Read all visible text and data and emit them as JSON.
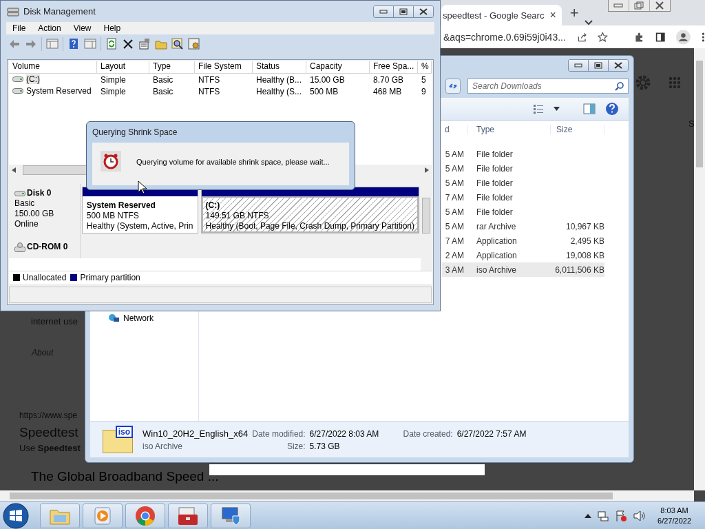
{
  "browser": {
    "tab_title": "speedtest - Google Searc",
    "tab_close": "×",
    "new_tab": "+",
    "url": "&aqs=chrome.0.69i59j0i43...",
    "page_texts": [
      {
        "kind": "snippet",
        "text": "internet use"
      },
      {
        "kind": "about",
        "text": "About"
      },
      {
        "kind": "url",
        "text": "https://www.spe"
      },
      {
        "kind": "title",
        "text": "Speedtest"
      },
      {
        "kind": "snippet",
        "text": "Use **Speedtest**"
      },
      {
        "kind": "heading",
        "text": "The Global Broadband Speed ..."
      }
    ],
    "side_text": "S"
  },
  "explorer": {
    "search_placeholder": "Search Downloads",
    "columns": [
      "d",
      "Type",
      "Size"
    ],
    "rows": [
      {
        "date": "5 AM",
        "type": "File folder",
        "selected": false
      },
      {
        "date": "5 AM",
        "type": "File folder",
        "selected": false
      },
      {
        "date": "5 AM",
        "type": "File folder",
        "selected": false
      },
      {
        "date": "7 AM",
        "type": "File folder",
        "selected": false
      },
      {
        "date": "5 AM",
        "type": "File folder",
        "selected": false
      },
      {
        "date": "5 AM",
        "type": "rar Archive",
        "size": "10,967 KB",
        "selected": false
      },
      {
        "date": "7 AM",
        "type": "Application",
        "size": "2,495 KB",
        "selected": false
      },
      {
        "date": "2 AM",
        "type": "Application",
        "size": "19,008 KB",
        "selected": false
      },
      {
        "date": "3 AM",
        "type": "iso Archive",
        "size": "6,011,506 KB",
        "selected": true
      }
    ],
    "nav_items": [
      {
        "label": "Network"
      }
    ],
    "details": {
      "icon_label": "iso",
      "name": "Win10_20H2_English_x64",
      "type": "iso Archive",
      "modified_label": "Date modified:",
      "modified": "6/27/2022 8:03 AM",
      "created_label": "Date created:",
      "created": "6/27/2022 7:57 AM",
      "size_label": "Size:",
      "size": "5.73 GB"
    }
  },
  "disk_management": {
    "title": "Disk Management",
    "menu": [
      "File",
      "Action",
      "View",
      "Help"
    ],
    "columns": [
      "Volume",
      "Layout",
      "Type",
      "File System",
      "Status",
      "Capacity",
      "Free Spa...",
      "%"
    ],
    "rows": [
      {
        "selected": true,
        "cells": [
          "(C:)",
          "Simple",
          "Basic",
          "NTFS",
          "Healthy (B...",
          "15.00 GB",
          "8.70 GB",
          "5"
        ]
      },
      {
        "selected": false,
        "cells": [
          "System Reserved",
          "Simple",
          "Basic",
          "NTFS",
          "Healthy (S...",
          "500 MB",
          "468 MB",
          "9"
        ]
      }
    ],
    "disks": [
      {
        "kind": "disk",
        "name": "Disk 0",
        "lines": [
          "Basic",
          "150.00 GB",
          "Online"
        ],
        "partitions": [
          {
            "name": "System Reserved",
            "size": "500 MB NTFS",
            "status": "Healthy (System, Active, Prin",
            "selected": false
          },
          {
            "name": "(C:)",
            "size": "149.51 GB NTFS",
            "status": "Healthy (Boot, Page File, Crash Dump, Primary Partition)",
            "selected": true
          }
        ]
      },
      {
        "kind": "cdrom",
        "name": "CD-ROM 0"
      }
    ],
    "legend": [
      {
        "label": "Unallocated",
        "color": "#000000"
      },
      {
        "label": "Primary partition",
        "color": "#000080"
      }
    ]
  },
  "dialog": {
    "title": "Querying Shrink Space",
    "message": "Querying volume for available shrink space, please wait..."
  },
  "taskbar": {
    "apps": [
      {
        "kind": "folder"
      },
      {
        "kind": "media"
      },
      {
        "kind": "chrome"
      },
      {
        "kind": "toolbox"
      },
      {
        "kind": "computer"
      }
    ],
    "time": "8:03 AM",
    "date": "6/27/2022"
  }
}
